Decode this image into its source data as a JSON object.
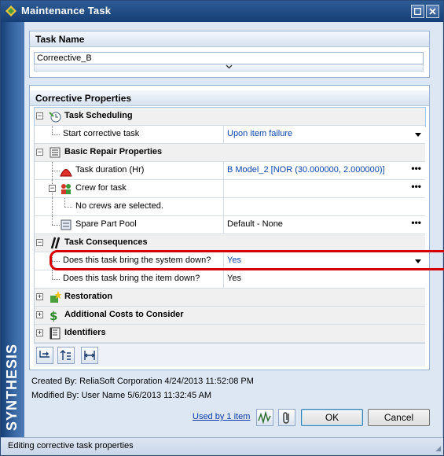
{
  "window": {
    "title": "Maintenance Task"
  },
  "brand": {
    "text": "SYNTHESIS"
  },
  "task_name": {
    "header": "Task Name",
    "value": "Correective_B"
  },
  "properties": {
    "header": "Corrective Properties",
    "rows": [
      {
        "kind": "cat",
        "label": "Task Scheduling",
        "icon": "clock-wrench-icon",
        "toggle": "−"
      },
      {
        "kind": "prop",
        "label": "Start corrective task",
        "value": "Upon item failure",
        "control": "dropdown",
        "value_color": "blue"
      },
      {
        "kind": "cat",
        "label": "Basic Repair Properties",
        "icon": "repair-list-icon",
        "toggle": "−"
      },
      {
        "kind": "prop",
        "label": "Task duration (Hr)",
        "value": "B Model_2 [NOR (30.000000, 2.000000)]",
        "control": "ellipsis",
        "icon": "distribution-icon",
        "value_color": "blue"
      },
      {
        "kind": "prop",
        "label": "Crew for task",
        "value": "",
        "control": "ellipsis",
        "icon": "crew-icon",
        "toggle": "−"
      },
      {
        "kind": "prop",
        "label": "No crews are selected.",
        "value": "",
        "control": "none"
      },
      {
        "kind": "prop",
        "label": "Spare Part Pool",
        "value": "Default - None",
        "control": "ellipsis",
        "icon": "spare-part-icon",
        "value_color": "black"
      },
      {
        "kind": "cat",
        "label": "Task Consequences",
        "icon": "consequence-icon",
        "toggle": "−"
      },
      {
        "kind": "prop",
        "label": "Does this task bring the system down?",
        "value": "Yes",
        "control": "dropdown",
        "value_color": "blue",
        "highlighted": true
      },
      {
        "kind": "prop",
        "label": "Does this task bring the item down?",
        "value": "Yes",
        "control": "none",
        "value_color": "black"
      },
      {
        "kind": "cat",
        "label": "Restoration",
        "icon": "restoration-icon",
        "toggle": "+"
      },
      {
        "kind": "cat",
        "label": "Additional Costs to Consider",
        "icon": "dollar-icon",
        "toggle": "+"
      },
      {
        "kind": "cat",
        "label": "Identifiers",
        "icon": "identifier-icon",
        "toggle": "+"
      }
    ]
  },
  "toolbar": {
    "buttons": [
      "expand-all-icon",
      "sort-icon",
      "columns-icon"
    ]
  },
  "meta": {
    "created": "Created By:   ReliaSoft Corporation 4/24/2013 11:52:08 PM",
    "modified": "Modified By:  User Name 5/6/2013 11:32:45 AM"
  },
  "footer": {
    "used_by": "Used by 1 item",
    "ok": "OK",
    "cancel": "Cancel"
  },
  "status": {
    "text": "Editing corrective task properties"
  },
  "colors": {
    "title_bar": "#1e4a82",
    "link": "#0b3aa6",
    "value_blue": "#0b46a8",
    "highlight": "#d40000"
  }
}
